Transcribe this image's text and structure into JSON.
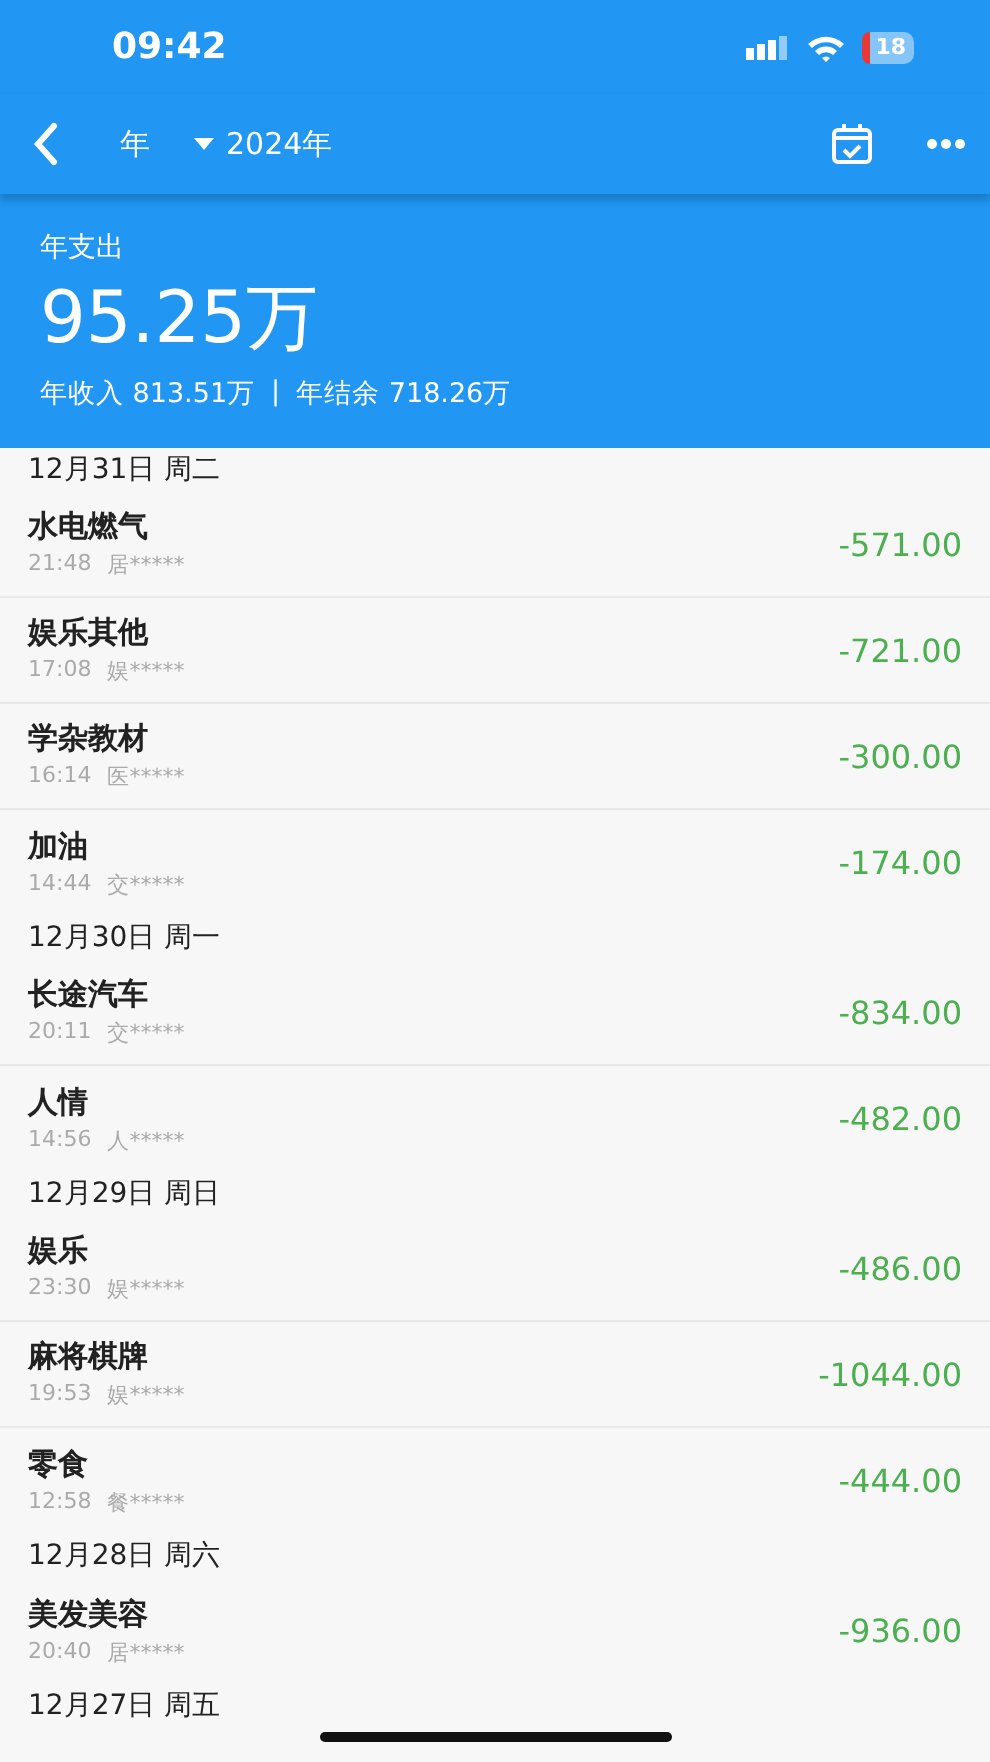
{
  "status_bar": {
    "time": "09:42",
    "battery": "18"
  },
  "nav": {
    "period": "年",
    "year": "2024年"
  },
  "summary": {
    "label": "年支出",
    "amount": "95.25万",
    "income": "年收入 813.51万",
    "separator": "|",
    "balance": "年结余 718.26万"
  },
  "days": [
    {
      "date": "12月31日 周二",
      "entries": [
        {
          "title": "水电燃气",
          "time": "21:48",
          "note": "居*****",
          "amount": "-571.00"
        },
        {
          "title": "娱乐其他",
          "time": "17:08",
          "note": "娱*****",
          "amount": "-721.00"
        },
        {
          "title": "学杂教材",
          "time": "16:14",
          "note": "医*****",
          "amount": "-300.00"
        },
        {
          "title": "加油",
          "time": "14:44",
          "note": "交*****",
          "amount": "-174.00"
        }
      ]
    },
    {
      "date": "12月30日 周一",
      "entries": [
        {
          "title": "长途汽车",
          "time": "20:11",
          "note": "交*****",
          "amount": "-834.00"
        },
        {
          "title": "人情",
          "time": "14:56",
          "note": "人*****",
          "amount": "-482.00"
        }
      ]
    },
    {
      "date": "12月29日 周日",
      "entries": [
        {
          "title": "娱乐",
          "time": "23:30",
          "note": "娱*****",
          "amount": "-486.00"
        },
        {
          "title": "麻将棋牌",
          "time": "19:53",
          "note": "娱*****",
          "amount": "-1044.00"
        },
        {
          "title": "零食",
          "time": "12:58",
          "note": "餐*****",
          "amount": "-444.00"
        }
      ]
    },
    {
      "date": "12月28日 周六",
      "entries": [
        {
          "title": "美发美容",
          "time": "20:40",
          "note": "居*****",
          "amount": "-936.00"
        }
      ]
    },
    {
      "date": "12月27日 周五"
    }
  ]
}
